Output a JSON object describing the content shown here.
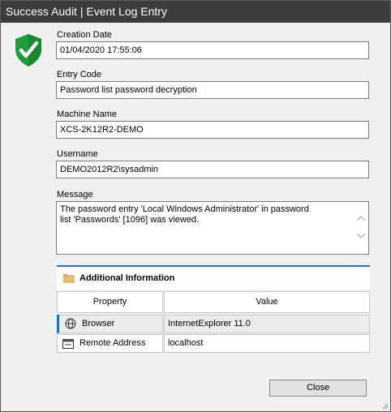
{
  "window": {
    "title": "Success Audit | Event Log Entry"
  },
  "fields": {
    "creation_date": {
      "label": "Creation Date",
      "value": "01/04/2020 17:55:06"
    },
    "entry_code": {
      "label": "Entry Code",
      "value": "Password list password decryption"
    },
    "machine_name": {
      "label": "Machine Name",
      "value": "XCS-2K12R2-DEMO"
    },
    "username": {
      "label": "Username",
      "value": "DEMO2012R2\\sysadmin"
    },
    "message": {
      "label": "Message",
      "line1": "The password entry 'Local Windows Administrator' in password",
      "line2": "list 'Passwords' [1096] was viewed."
    }
  },
  "additional_info": {
    "title": "Additional Information",
    "columns": [
      "Property",
      "Value"
    ],
    "rows": [
      {
        "property": "Browser",
        "value": "InternetExplorer 11.0",
        "icon": "globe-icon"
      },
      {
        "property": "Remote Address",
        "value": "localhost",
        "icon": "monitor-icon"
      }
    ]
  },
  "buttons": {
    "close": "Close"
  },
  "colors": {
    "titlebar": "#3c3c3c",
    "accent": "#2f6eb5",
    "shield": "#1e9e3a"
  }
}
